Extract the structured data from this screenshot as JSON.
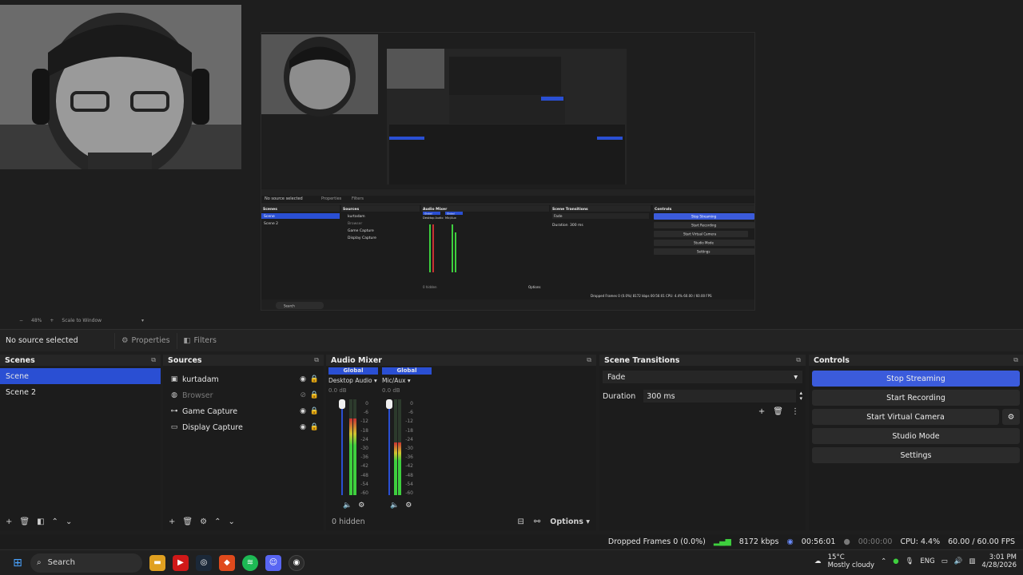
{
  "window": {
    "controls": [
      "—",
      "☐",
      "✕"
    ]
  },
  "preview": {
    "zoom": "48%",
    "scale_mode": "Scale to Window",
    "inner": {
      "no_source": "No source selected",
      "properties": "Properties",
      "filters": "Filters",
      "dock_titles": [
        "Scenes",
        "Sources",
        "Audio Mixer",
        "Scene Transitions",
        "Controls"
      ],
      "scenes": [
        "Scene",
        "Scene 2"
      ],
      "sources": [
        "kurtadam",
        "Browser",
        "Game Capture",
        "Display Capture"
      ],
      "mixer_global": "Global",
      "mixer_channels": [
        "Desktop Audio",
        "Mic/Aux"
      ],
      "transition": "Fade",
      "duration_label": "Duration",
      "duration": "300 ms",
      "controls": [
        "Stop Streaming",
        "Start Recording",
        "Start Virtual Camera",
        "Studio Mode",
        "Settings"
      ],
      "hidden": "0 hidden",
      "options": "Options",
      "status": "Dropped Frames 0 (0.0%)  8172 kbps  00:56:01  CPU: 4.4%  60.00 / 60.00 FPS",
      "search": "Search"
    }
  },
  "context": {
    "no_source": "No source selected",
    "properties": "Properties",
    "filters": "Filters"
  },
  "scenes": {
    "title": "Scenes",
    "items": [
      {
        "label": "Scene",
        "selected": true
      },
      {
        "label": "Scene 2",
        "selected": false
      }
    ]
  },
  "sources": {
    "title": "Sources",
    "items": [
      {
        "label": "kurtadam",
        "icon": "image-icon",
        "visible": true
      },
      {
        "label": "Browser",
        "icon": "globe-icon",
        "visible": false
      },
      {
        "label": "Game Capture",
        "icon": "gamepad-icon",
        "visible": true
      },
      {
        "label": "Display Capture",
        "icon": "monitor-icon",
        "visible": true
      }
    ]
  },
  "mixer": {
    "title": "Audio Mixer",
    "channels": [
      {
        "badge": "Global",
        "name": "Desktop Audio",
        "db": "0.0 dB",
        "level": 0.8
      },
      {
        "badge": "Global",
        "name": "Mic/Aux",
        "db": "0.0 dB",
        "level": 0.55
      }
    ],
    "scale": [
      "0",
      "-6",
      "-12",
      "-18",
      "-24",
      "-30",
      "-36",
      "-42",
      "-48",
      "-54",
      "-60"
    ],
    "hidden": "0 hidden",
    "options": "Options"
  },
  "transitions": {
    "title": "Scene Transitions",
    "selected": "Fade",
    "duration_label": "Duration",
    "duration": "300 ms"
  },
  "controls": {
    "title": "Controls",
    "stop_streaming": "Stop Streaming",
    "start_recording": "Start Recording",
    "start_virtual_camera": "Start Virtual Camera",
    "studio_mode": "Studio Mode",
    "settings": "Settings"
  },
  "status": {
    "dropped": "Dropped Frames 0 (0.0%)",
    "bitrate": "8172 kbps",
    "stream_time": "00:56:01",
    "record_time": "00:00:00",
    "cpu": "CPU: 4.4%",
    "fps": "60.00 / 60.00 FPS"
  },
  "taskbar": {
    "search": "Search",
    "weather_temp": "15°C",
    "weather_desc": "Mostly cloudy",
    "lang": "ENG",
    "time": "3:01 PM",
    "date": "4/28/2026"
  },
  "colors": {
    "accent": "#2a4fd3",
    "bg": "#1e1e1e",
    "panel": "#1c1c1c"
  }
}
